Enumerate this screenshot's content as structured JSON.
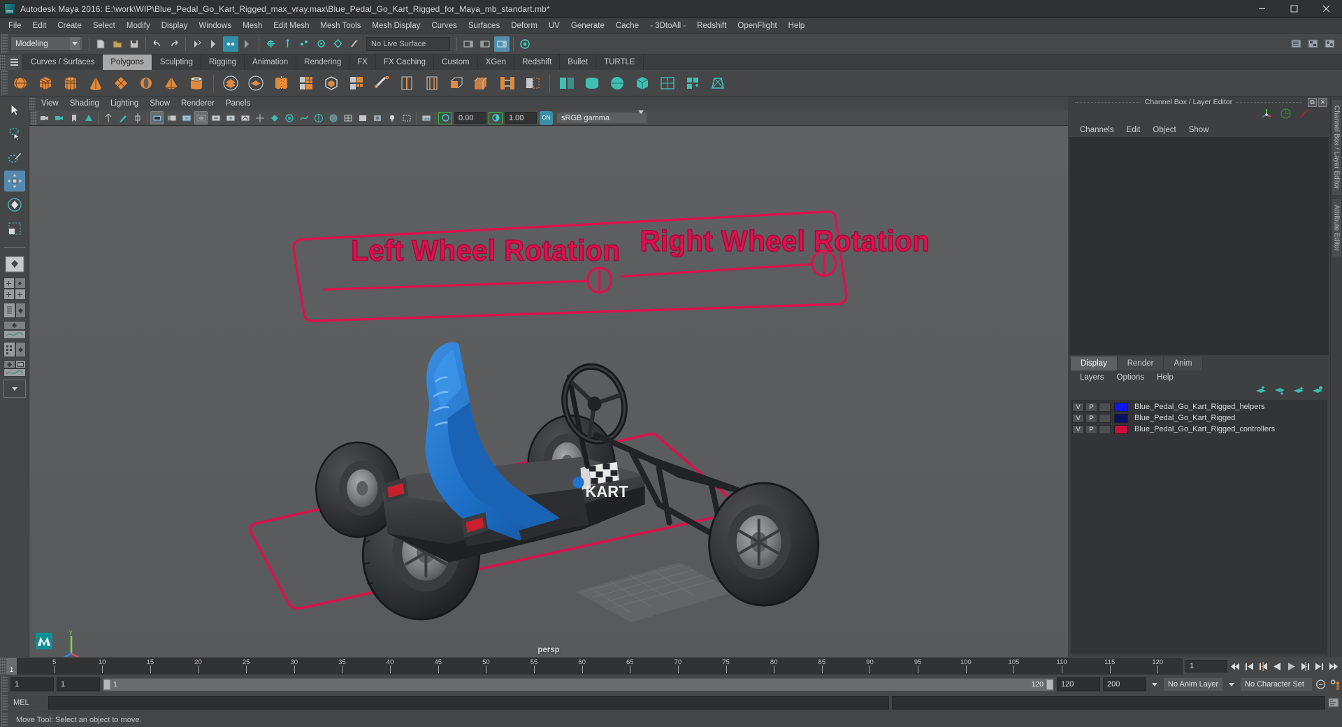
{
  "window": {
    "title": "Autodesk Maya 2016: E:\\work\\WIP\\Blue_Pedal_Go_Kart_Rigged_max_vray.max\\Blue_Pedal_Go_Kart_Rigged_for_Maya_mb_standart.mb*",
    "minimize": "minimize-button",
    "maximize": "maximize-button",
    "close": "close-button"
  },
  "menubar": {
    "items": [
      "File",
      "Edit",
      "Create",
      "Select",
      "Modify",
      "Display",
      "Windows",
      "Mesh",
      "Edit Mesh",
      "Mesh Tools",
      "Mesh Display",
      "Curves",
      "Surfaces",
      "Deform",
      "UV",
      "Generate",
      "Cache",
      "- 3DtoAll -",
      "Redshift",
      "OpenFlight",
      "Help"
    ]
  },
  "statusline": {
    "menu_set": "Modeling",
    "live_surface": "No Live Surface"
  },
  "shelf": {
    "tabs": [
      "Curves / Surfaces",
      "Polygons",
      "Sculpting",
      "Rigging",
      "Animation",
      "Rendering",
      "FX",
      "FX Caching",
      "Custom",
      "XGen",
      "Redshift",
      "Bullet",
      "TURTLE"
    ],
    "active_tab": "Polygons"
  },
  "viewport": {
    "menu": [
      "View",
      "Shading",
      "Lighting",
      "Show",
      "Renderer",
      "Panels"
    ],
    "exposure": "0.00",
    "gamma": "1.00",
    "color_management": "sRGB gamma",
    "cm_toggle": "ON",
    "camera_label": "persp"
  },
  "right_panel": {
    "title": "Channel Box / Layer Editor",
    "side_tabs": [
      "Channel Box / Layer Editor",
      "Attribute Editor"
    ],
    "channel_menu": [
      "Channels",
      "Edit",
      "Object",
      "Show"
    ],
    "layer_tabs": [
      "Display",
      "Render",
      "Anim"
    ],
    "active_layer_tab": "Display",
    "layer_menu": [
      "Layers",
      "Options",
      "Help"
    ],
    "layers": [
      {
        "v": "V",
        "p": "P",
        "third": "",
        "color": "#0d16f5",
        "name": "Blue_Pedal_Go_Kart_Rigged_helpers"
      },
      {
        "v": "V",
        "p": "P",
        "third": "",
        "color": "#0a1068",
        "name": "Blue_Pedal_Go_Kart_Rigged"
      },
      {
        "v": "V",
        "p": "P",
        "third": "",
        "color": "#cc0b3f",
        "name": "Blue_Pedal_Go_Kart_Rigged_controllers"
      }
    ]
  },
  "timeline": {
    "ticks": [
      "5",
      "10",
      "15",
      "20",
      "25",
      "30",
      "35",
      "40",
      "45",
      "50",
      "55",
      "60",
      "65",
      "70",
      "75",
      "80",
      "85",
      "90",
      "95",
      "100",
      "105",
      "110",
      "115",
      "120"
    ],
    "current_frame": "1",
    "frame_field": "1",
    "start_field": "1",
    "end_field": "1",
    "range_start_label": "1",
    "range_end_label": "120",
    "playback_end": "120",
    "anim_end": "200",
    "anim_layer": "No Anim Layer",
    "character_set": "No Character Set"
  },
  "command_line": {
    "language": "MEL",
    "input_value": "",
    "placeholder": ""
  },
  "status_help": {
    "message": "Move Tool: Select an object to move."
  },
  "scene": {
    "annotations": [
      {
        "text": "Left Wheel Rotation",
        "color": "#e01050"
      },
      {
        "text": "Right Wheel Rotation",
        "color": "#e01050"
      }
    ],
    "kart_decal": "KART",
    "colors": {
      "controller_pink": "#e0104f",
      "seat_blue": "#1f74d0",
      "body_dark": "#2e3032",
      "viewport_bg": "#5c5e60"
    }
  }
}
